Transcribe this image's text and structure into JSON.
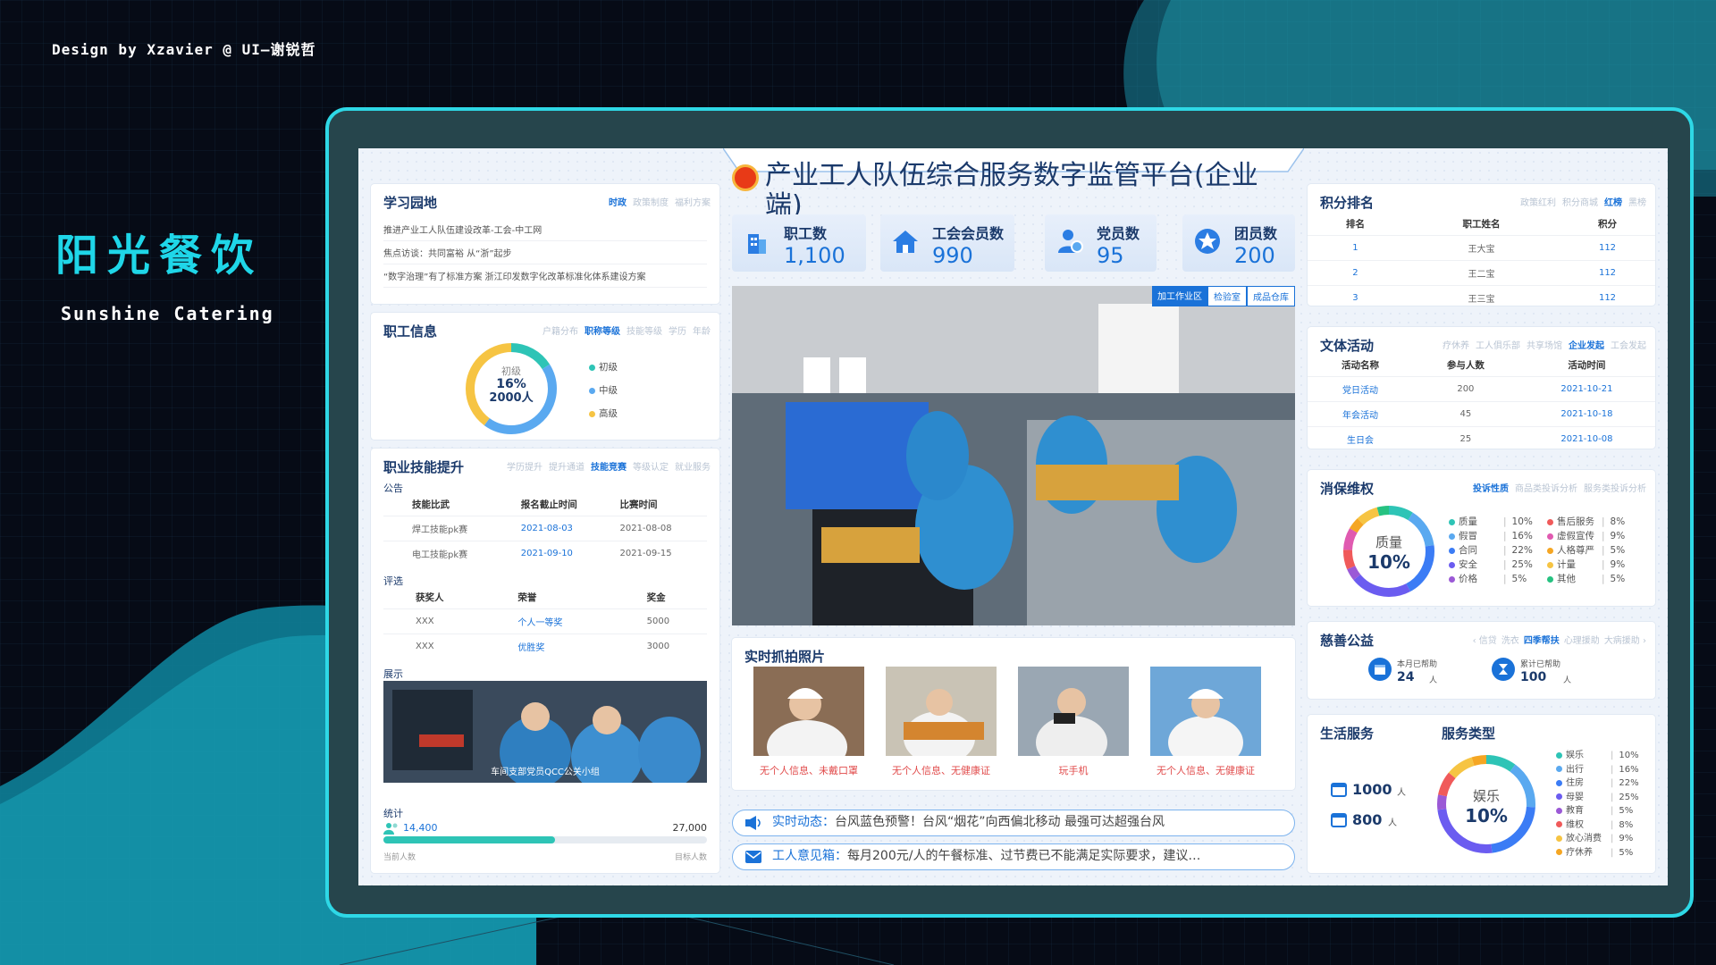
{
  "credit": "Design by Xzavier @ UI—谢锐哲",
  "brand": {
    "cn": "阳光餐饮",
    "en": "Sunshine Catering"
  },
  "platform_title": "产业工人队伍综合服务数字监管平台(企业端)",
  "stats": [
    {
      "label": "职工数",
      "value": "1,100",
      "icon": "building-icon"
    },
    {
      "label": "工会会员数",
      "value": "990",
      "icon": "house-icon"
    },
    {
      "label": "党员数",
      "value": "95",
      "icon": "person-icon"
    },
    {
      "label": "团员数",
      "value": "200",
      "icon": "star-badge-icon"
    }
  ],
  "study": {
    "title": "学习园地",
    "tabs": [
      "时政",
      "政策制度",
      "福利方案"
    ],
    "active": 0,
    "items": [
      "推进产业工人队伍建设改革-工会-中工网",
      "焦点访谈：共同富裕 从“浙”起步",
      "“数字治理”有了标准方案 浙江印发数字化改革标准化体系建设方案"
    ]
  },
  "staff": {
    "title": "职工信息",
    "tabs": [
      "户籍分布",
      "职称等级",
      "技能等级",
      "学历",
      "年龄"
    ],
    "active": 1,
    "donut": {
      "label": "初级",
      "pct": "16%",
      "count": "2000人"
    },
    "legend": [
      {
        "name": "初级",
        "color": "#2ec4b6"
      },
      {
        "name": "中级",
        "color": "#5aa9f0"
      },
      {
        "name": "高级",
        "color": "#f6c443"
      }
    ],
    "shares": [
      16,
      44,
      40
    ]
  },
  "skill": {
    "title": "职业技能提升",
    "tabs": [
      "学历提升",
      "提升通道",
      "技能竞赛",
      "等级认定",
      "就业服务"
    ],
    "active": 2,
    "notice_label": "公告",
    "notice_headers": [
      "技能比武",
      "报名截止时间",
      "比赛时间"
    ],
    "notices": [
      [
        "焊工技能pk赛",
        "2021-08-03",
        "2021-08-08"
      ],
      [
        "电工技能pk赛",
        "2021-09-10",
        "2021-09-15"
      ]
    ],
    "eval_label": "评选",
    "eval_headers": [
      "获奖人",
      "荣誉",
      "奖金"
    ],
    "evals": [
      [
        "XXX",
        "个人一等奖",
        "5000"
      ],
      [
        "XXX",
        "优胜奖",
        "3000"
      ]
    ],
    "show_label": "展示",
    "show_caption": "车间支部党员QCC公关小组",
    "stat_label": "统计",
    "current": "14,400",
    "target": "27,000",
    "current_label": "当前人数",
    "target_label": "目标人数",
    "progress": 0.53
  },
  "photo_tabs": [
    "加工作业区",
    "检验室",
    "成品仓库"
  ],
  "captures": {
    "title": "实时抓拍照片",
    "items": [
      {
        "caption": "无个人信息、未戴口罩"
      },
      {
        "caption": "无个人信息、无健康证"
      },
      {
        "caption": "玩手机"
      },
      {
        "caption": "无个人信息、无健康证"
      }
    ]
  },
  "ticker1": {
    "key": "实时动态：",
    "text": "台风蓝色预警！台风“烟花”向西偏北移动 最强可达超强台风"
  },
  "ticker2": {
    "key": "工人意见箱：",
    "text": "每月200元/人的午餐标准、过节费已不能满足实际要求，建议…"
  },
  "points": {
    "title": "积分排名",
    "tabs": [
      "政策红利",
      "积分商城",
      "红榜",
      "黑榜"
    ],
    "active": 2,
    "headers": [
      "排名",
      "职工姓名",
      "积分"
    ],
    "rows": [
      [
        "1",
        "王大宝",
        "112"
      ],
      [
        "2",
        "王二宝",
        "112"
      ],
      [
        "3",
        "王三宝",
        "112"
      ]
    ]
  },
  "culture": {
    "title": "文体活动",
    "tabs": [
      "疗休养",
      "工人俱乐部",
      "共享场馆",
      "企业发起",
      "工会发起"
    ],
    "active": 3,
    "headers": [
      "活动名称",
      "参与人数",
      "活动时间"
    ],
    "rows": [
      [
        "党日活动",
        "200",
        "2021-10-21"
      ],
      [
        "年会活动",
        "45",
        "2021-10-18"
      ],
      [
        "生日会",
        "25",
        "2021-10-08"
      ]
    ]
  },
  "consumer": {
    "title": "消保维权",
    "tabs": [
      "投诉性质",
      "商品类投诉分析",
      "服务类投诉分析"
    ],
    "active": 0,
    "donut": {
      "label": "质量",
      "pct": "10%"
    },
    "left": [
      {
        "n": "质量",
        "p": "10%",
        "c": "#2ec4b6"
      },
      {
        "n": "假冒",
        "p": "16%",
        "c": "#5aa9f0"
      },
      {
        "n": "合同",
        "p": "22%",
        "c": "#3b7cf5"
      },
      {
        "n": "安全",
        "p": "25%",
        "c": "#6b5cf0"
      },
      {
        "n": "价格",
        "p": "5%",
        "c": "#9b59d6"
      }
    ],
    "right": [
      {
        "n": "售后服务",
        "p": "8%",
        "c": "#f05a5a"
      },
      {
        "n": "虚假宣传",
        "p": "9%",
        "c": "#e05ab0"
      },
      {
        "n": "人格尊严",
        "p": "5%",
        "c": "#f5a623"
      },
      {
        "n": "计量",
        "p": "9%",
        "c": "#f6c443"
      },
      {
        "n": "其他",
        "p": "5%",
        "c": "#26c281"
      }
    ]
  },
  "charity": {
    "title": "慈善公益",
    "tabs": [
      "‹ 信贷",
      "洗衣",
      "四季帮扶",
      "心理援助",
      "大病援助 ›"
    ],
    "active": 2,
    "month_label": "本月已帮助",
    "month_val": "24",
    "total_label": "累计已帮助",
    "total_val": "100",
    "unit": "人"
  },
  "life": {
    "title": "生活服务",
    "type_title": "服务类型",
    "a": "1000",
    "b": "800",
    "unit": "人",
    "donut": {
      "label": "娱乐",
      "pct": "10%"
    },
    "legend": [
      {
        "n": "娱乐",
        "p": "10%",
        "c": "#2ec4b6"
      },
      {
        "n": "出行",
        "p": "16%",
        "c": "#5aa9f0"
      },
      {
        "n": "住房",
        "p": "22%",
        "c": "#3b7cf5"
      },
      {
        "n": "母婴",
        "p": "25%",
        "c": "#6b5cf0"
      },
      {
        "n": "教育",
        "p": "5%",
        "c": "#9b59d6"
      },
      {
        "n": "维权",
        "p": "8%",
        "c": "#f05a5a"
      },
      {
        "n": "放心消费",
        "p": "9%",
        "c": "#f6c443"
      },
      {
        "n": "疗休养",
        "p": "5%",
        "c": "#f5a623"
      }
    ]
  }
}
